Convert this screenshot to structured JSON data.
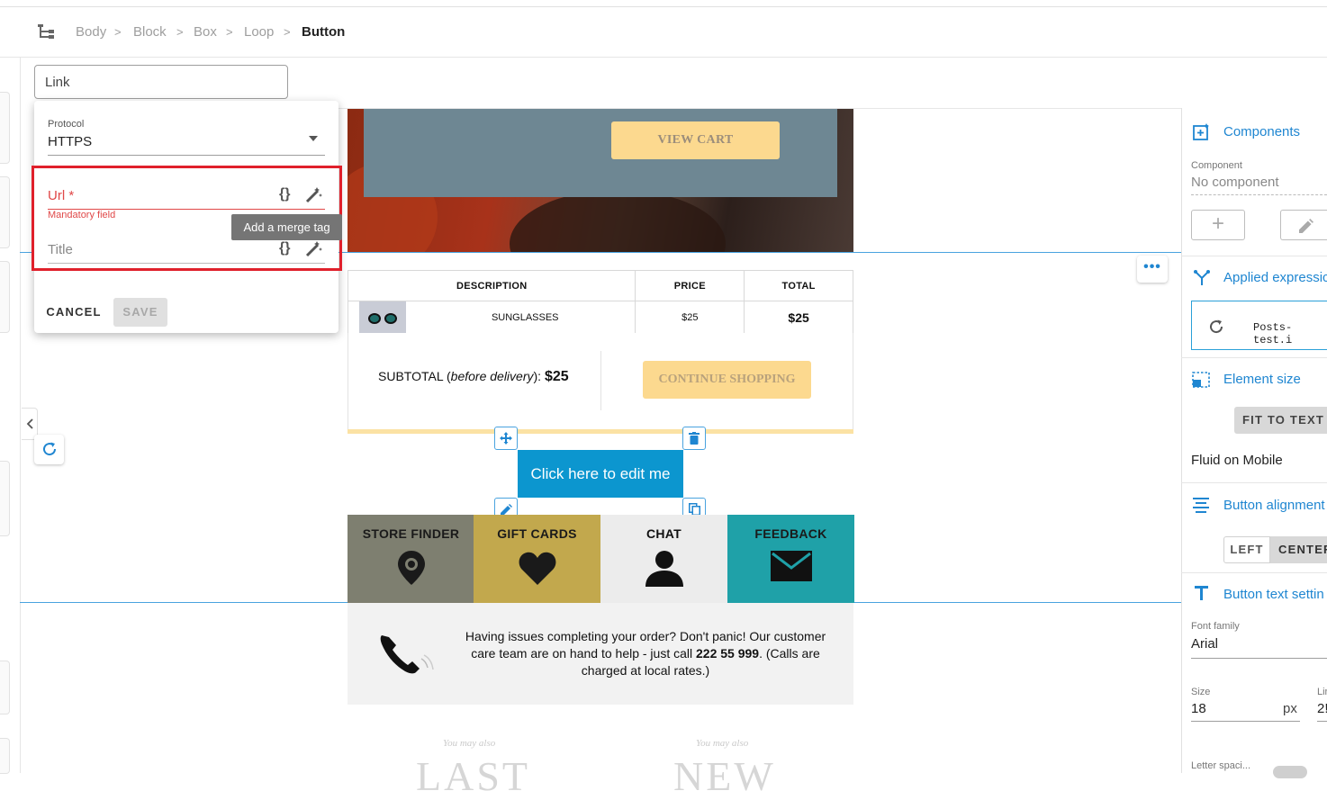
{
  "breadcrumb": {
    "items": [
      "Body",
      "Block",
      "Box",
      "Loop"
    ],
    "current": "Button",
    "separator": ">"
  },
  "link_field": {
    "value": "Link"
  },
  "link_popup": {
    "protocol_label": "Protocol",
    "protocol_value": "HTTPS",
    "url_label": "Url *",
    "url_error": "Mandatory field",
    "title_label": "Title",
    "merge_tag_glyph": "{}",
    "tooltip": "Add a merge tag",
    "cancel_label": "CANCEL",
    "save_label": "SAVE"
  },
  "email": {
    "view_cart": "VIEW CART",
    "table_headers": [
      "DESCRIPTION",
      "PRICE",
      "TOTAL"
    ],
    "table_row": {
      "description": "SUNGLASSES",
      "price": "$25",
      "total": "$25"
    },
    "subtotal_prefix": "SUBTOTAL (",
    "subtotal_italic": "before delivery",
    "subtotal_suffix": "): ",
    "subtotal_value": "$25",
    "continue_shopping": "CONTINUE SHOPPING",
    "selected_button": "Click here to edit me",
    "tiles": [
      {
        "label": "STORE FINDER",
        "icon": "map-pin-icon",
        "bg": "#7e7f70",
        "color": "#1a1a1a"
      },
      {
        "label": "GIFT CARDS",
        "icon": "heart-icon",
        "bg": "#c2a84d",
        "color": "#1a1a1a"
      },
      {
        "label": "CHAT",
        "icon": "person-icon",
        "bg": "#ececec",
        "color": "#111111"
      },
      {
        "label": "FEEDBACK",
        "icon": "envelope-icon",
        "bg": "#1fa1a8",
        "color": "#1a1a1a"
      }
    ],
    "help_line1": "Having issues completing your order? Don't panic! Our customer care team are on hand to help - just call ",
    "help_phone": "222 55 999",
    "help_line2": ". (Calls are charged at local rates.)",
    "you_may_also_1": "You may also",
    "you_may_also_2": "You may also",
    "big_word_1": "LAST",
    "big_word_2": "NEW"
  },
  "right_panel": {
    "components_title": "Components",
    "component_label": "Component",
    "component_value": "No component",
    "applied_title": "Applied expressic",
    "applied_value": "Posts-test.i",
    "element_size_title": "Element size",
    "fit_to_text": "FIT TO TEXT",
    "fluid_mobile": "Fluid on Mobile",
    "alignment_title": "Button alignment",
    "align_left": "LEFT",
    "align_center": "CENTER",
    "text_settings_title": "Button text settin",
    "font_family_label": "Font family",
    "font_family_value": "Arial",
    "size_label": "Size",
    "size_value": "18",
    "size_unit": "px",
    "line_label": "Lir",
    "line_value": "2!",
    "letter_spacing_label": "Letter spaci..."
  },
  "colors": {
    "accent": "#1f86d1",
    "error": "#e04848",
    "highlight": "#e0202b",
    "button": "#0c96cf",
    "cta": "#fcd98f"
  }
}
